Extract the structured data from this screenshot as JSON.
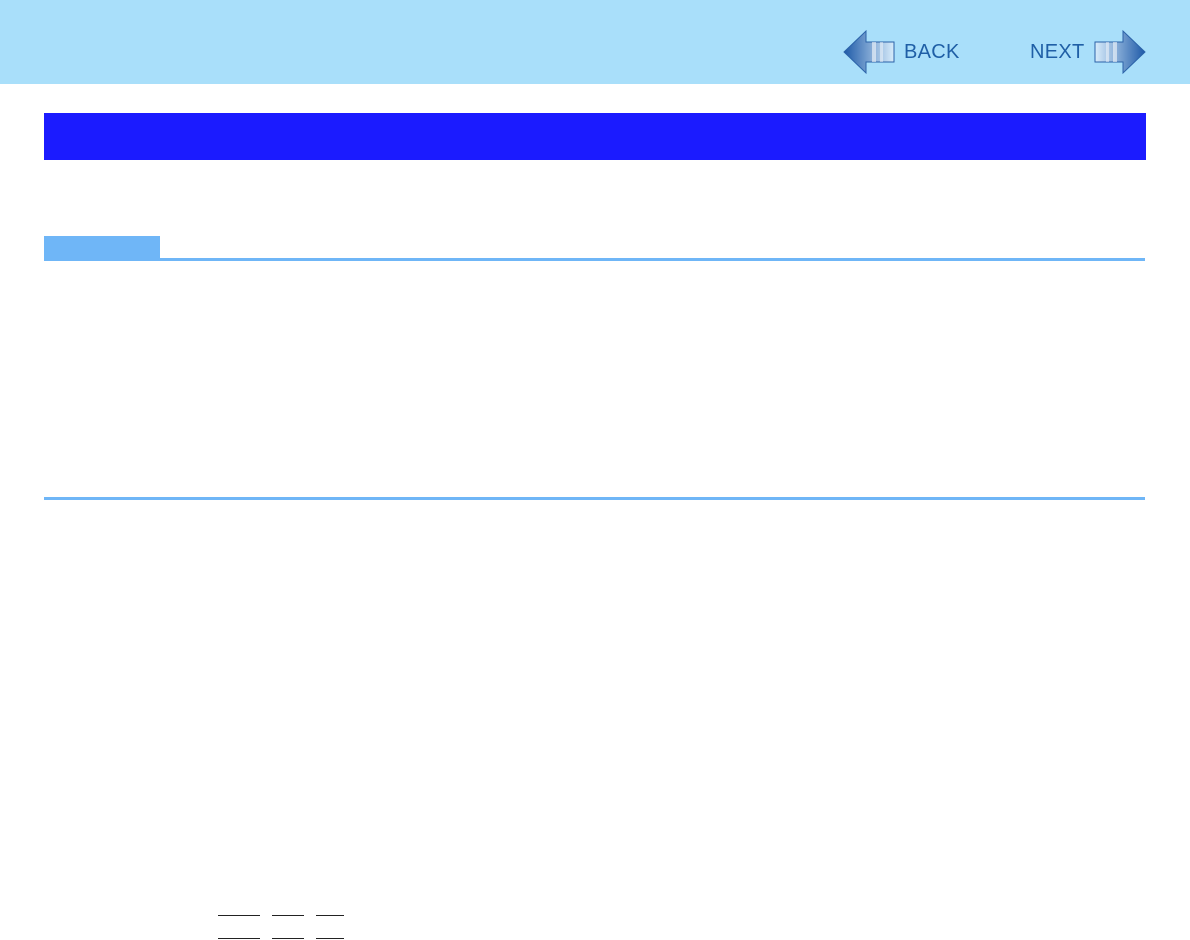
{
  "nav": {
    "back_label": "BACK",
    "next_label": "NEXT",
    "back_icon": "arrow-left-icon",
    "next_icon": "arrow-right-icon"
  },
  "colors": {
    "top_bar": "#a9dffa",
    "title_bar": "#1b1bff",
    "note_accent": "#6fb6f7",
    "nav_text": "#1f5fa6"
  }
}
